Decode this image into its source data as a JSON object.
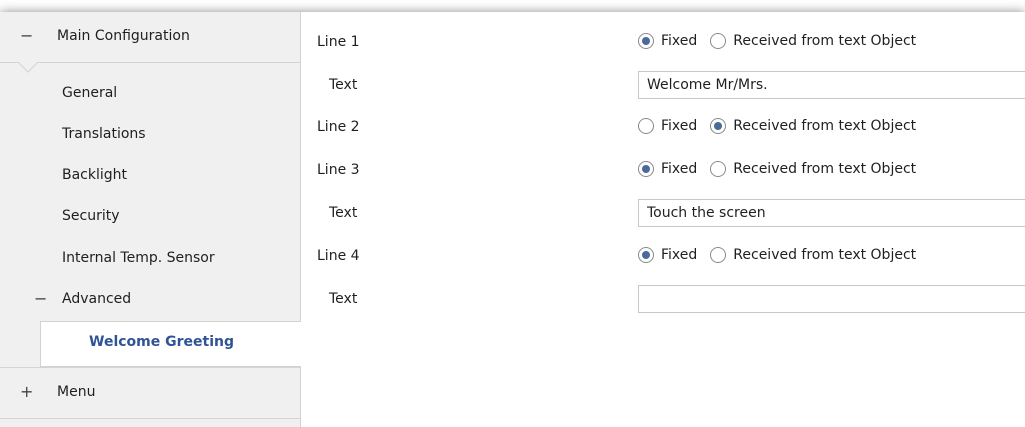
{
  "sidebar": {
    "header": {
      "toggle": "−",
      "label": "Main Configuration"
    },
    "items": [
      {
        "label": "General"
      },
      {
        "label": "Translations"
      },
      {
        "label": "Backlight"
      },
      {
        "label": "Security"
      },
      {
        "label": "Internal Temp. Sensor"
      }
    ],
    "advanced": {
      "toggle": "−",
      "label": "Advanced"
    },
    "active": {
      "label": "Welcome Greeting"
    },
    "menu": {
      "toggle": "+",
      "label": "Menu"
    }
  },
  "main": {
    "line1": {
      "label": "Line 1",
      "opt_fixed": "Fixed",
      "opt_received": "Received from text Object",
      "selected": "fixed"
    },
    "text1": {
      "label": "Text",
      "value": "Welcome Mr/Mrs."
    },
    "line2": {
      "label": "Line 2",
      "opt_fixed": "Fixed",
      "opt_received": "Received from text Object",
      "selected": "received"
    },
    "line3": {
      "label": "Line 3",
      "opt_fixed": "Fixed",
      "opt_received": "Received from text Object",
      "selected": "fixed"
    },
    "text3": {
      "label": "Text",
      "value": "Touch the screen"
    },
    "line4": {
      "label": "Line 4",
      "opt_fixed": "Fixed",
      "opt_received": "Received from text Object",
      "selected": "fixed"
    },
    "text4": {
      "label": "Text",
      "value": ""
    }
  },
  "colors": {
    "accent": "#2f5496",
    "radio_dot": "#4a6a9a",
    "sidebar_bg": "#f0f0f0"
  }
}
